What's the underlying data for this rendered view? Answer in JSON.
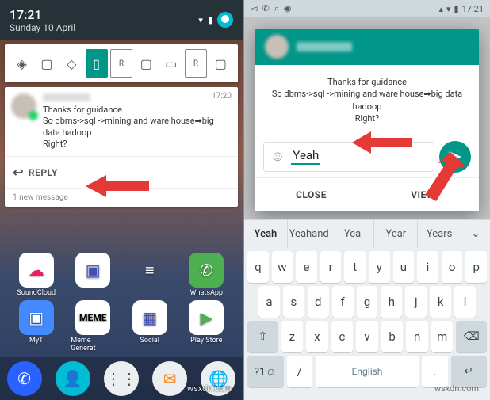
{
  "left": {
    "status": {
      "time": "17:21",
      "date": "Sunday 10 April"
    },
    "toggle_icons": [
      "auto-rotate",
      "shield",
      "rotate",
      "phone-active",
      "r-box",
      "vibrate",
      "landscape",
      "r-box-2",
      "tablet"
    ],
    "notification": {
      "time": "17:20",
      "sender_blurred": true,
      "lines": [
        "Thanks for guidance",
        "So dbms->sql ->mining and ware house➡big data hadoop",
        "Right?"
      ],
      "action_label": "REPLY",
      "footer": "1 new message"
    },
    "apps_row1": [
      {
        "label": "SoundCloud"
      },
      {
        "label": ""
      },
      {
        "label": ""
      },
      {
        "label": "WhatsApp"
      }
    ],
    "apps_row2": [
      {
        "label": "MyT"
      },
      {
        "label": "Meme Generat"
      },
      {
        "label": "Social"
      },
      {
        "label": "Play Store"
      }
    ]
  },
  "right": {
    "status_time": "17:21",
    "dialog": {
      "sender_blurred": true,
      "message_lines": [
        "Thanks for guidance",
        "So dbms->sql ->mining and ware house➡big data hadoop",
        "Right?"
      ],
      "reply_text": "Yeah",
      "close_label": "CLOSE",
      "view_label": "VIEW"
    },
    "suggestions": [
      "Yeah",
      "Yeahand",
      "Yea",
      "Year",
      "Years"
    ],
    "keyboard": {
      "row1": [
        "q",
        "w",
        "e",
        "r",
        "t",
        "y",
        "u",
        "i",
        "o",
        "p"
      ],
      "row2": [
        "a",
        "s",
        "d",
        "f",
        "g",
        "h",
        "j",
        "k",
        "l"
      ],
      "row3": [
        "⇧",
        "z",
        "x",
        "c",
        "v",
        "b",
        "n",
        "m",
        "⌫"
      ],
      "row4": [
        "?1☺",
        "/",
        "English",
        ".",
        "↵"
      ],
      "space_label": "English"
    }
  },
  "watermark": "wsxdn.com"
}
